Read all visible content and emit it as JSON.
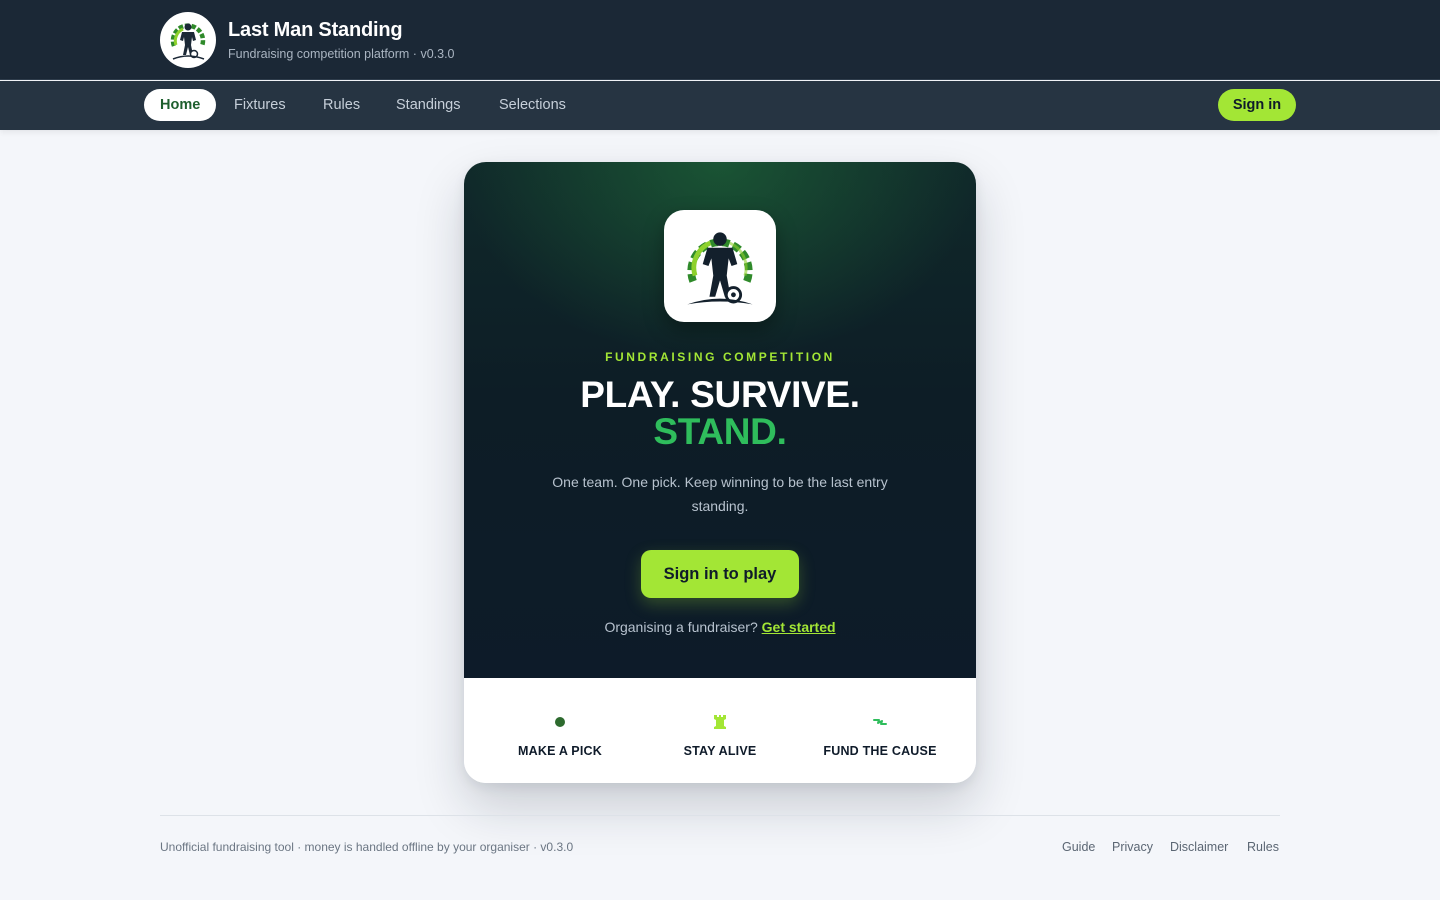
{
  "header": {
    "title": "Last Man Standing",
    "subtitle": "Fundraising competition platform · v0.3.0",
    "logo_icon": "footballer-logo-icon"
  },
  "nav": {
    "items": [
      {
        "label": "Home",
        "active": true
      },
      {
        "label": "Fixtures",
        "active": false
      },
      {
        "label": "Rules",
        "active": false
      },
      {
        "label": "Standings",
        "active": false
      },
      {
        "label": "Selections",
        "active": false
      }
    ],
    "signin_label": "Sign in"
  },
  "hero": {
    "eyebrow": "FUNDRAISING COMPETITION",
    "headline_line1": "PLAY. SURVIVE.",
    "headline_line2": "STAND.",
    "tagline": "One team. One pick. Keep winning to be the last entry standing.",
    "cta_label": "Sign in to play",
    "organiser_prompt": "Organising a fundraiser?",
    "organiser_link": "Get started"
  },
  "features": [
    {
      "label": "MAKE A PICK",
      "icon": "dot-icon"
    },
    {
      "label": "STAY ALIVE",
      "icon": "rook-icon"
    },
    {
      "label": "FUND THE CAUSE",
      "icon": "lightning-icon"
    }
  ],
  "footer": {
    "text": "Unofficial fundraising tool · money is handled offline by your organiser · v0.3.0",
    "links": [
      "Guide",
      "Privacy",
      "Disclaimer",
      "Rules"
    ]
  },
  "colors": {
    "header_bg": "#1b2836",
    "nav_bg": "#263442",
    "accent_lime": "#a3e635",
    "accent_green": "#2fbd5c",
    "hero_bg": "#0d1b29"
  }
}
